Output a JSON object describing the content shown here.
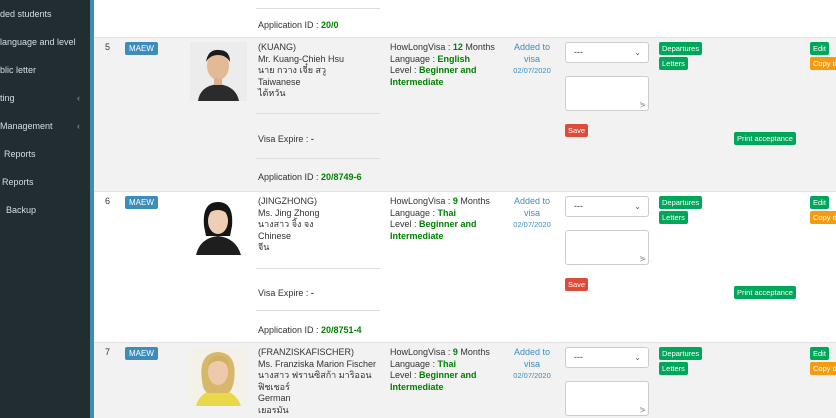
{
  "sidebar": {
    "items": [
      {
        "label": "ded students",
        "chevron": false
      },
      {
        "label": "language and level",
        "chevron": false
      },
      {
        "label": "blic letter",
        "chevron": false
      },
      {
        "label": "ting",
        "chevron": true
      },
      {
        "label": " Management",
        "chevron": true
      },
      {
        "label": "Reports",
        "chevron": false
      },
      {
        "label": "Reports",
        "chevron": false
      },
      {
        "label": "Backup",
        "chevron": false
      }
    ]
  },
  "top_partial": {
    "application_label": "Application ID : ",
    "application_id": "20/0"
  },
  "common": {
    "tag": "MAEW",
    "howlong_label": "HowLongVisa : ",
    "language_label": "Language : ",
    "level_label": "Level : ",
    "added_line1": "Added to",
    "added_line2": "visa",
    "select_value": "---",
    "save_label": "Save",
    "departures_label": "Departures",
    "letters_label": "Letters",
    "print_label": "Print acceptance",
    "edit_label": "Edit",
    "copy_label": "Copy d",
    "visa_expire_label": "Visa Expire : ",
    "application_label": "Application ID : "
  },
  "students": [
    {
      "num": "5",
      "nickname": "(KUANG)",
      "name_en": "Mr. Kuang-Chieh Hsu",
      "name_th": "นาย กวาง เจี๋ย สวู",
      "nationality": "Taiwanese",
      "nationality_th": "ไต้หวัน",
      "months": "12",
      "months_unit": " Months",
      "language": "English",
      "level": "Beginner and Intermediate",
      "added_date": "02/07/2020",
      "visa_expire": "-",
      "application_id": "20/8749-6"
    },
    {
      "num": "6",
      "nickname": "(JINGZHONG)",
      "name_en": "Ms. Jing Zhong",
      "name_th": "นางสาว จิ้ง จง",
      "nationality": "Chinese",
      "nationality_th": "จีน",
      "months": "9",
      "months_unit": " Months",
      "language": "Thai",
      "level": "Beginner and Intermediate",
      "added_date": "02/07/2020",
      "visa_expire": "-",
      "application_id": "20/8751-4"
    },
    {
      "num": "7",
      "nickname": "(FRANZISKAFISCHER)",
      "name_en": "Ms. Franziska Marion Fischer",
      "name_th": "นางสาว ฟรานซิสก้า มาริออน ฟิชเชอร์",
      "nationality": "German",
      "nationality_th": "เยอรมัน",
      "months": "9",
      "months_unit": " Months",
      "language": "Thai",
      "level": "Beginner and Intermediate",
      "added_date": "02/07/2020"
    }
  ]
}
